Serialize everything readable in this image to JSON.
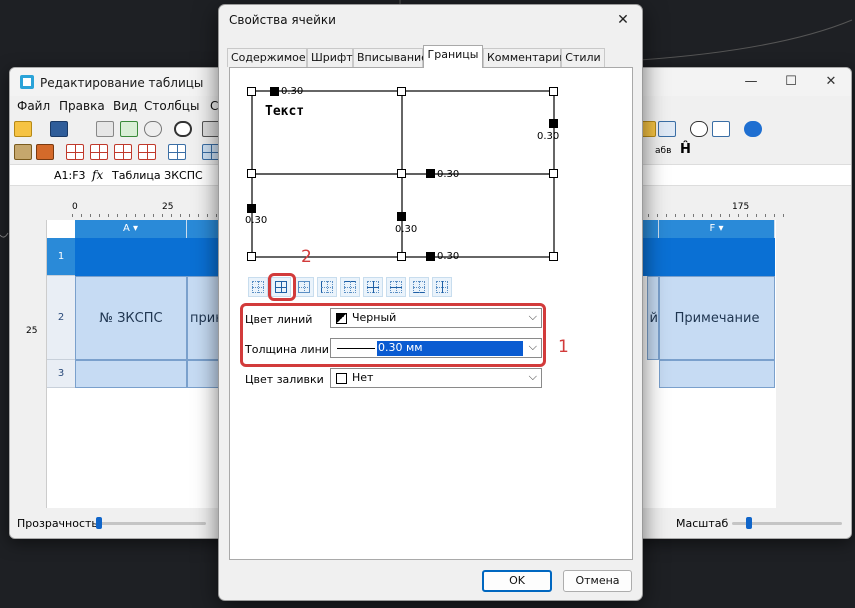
{
  "background_window": {
    "title": "Редактирование таблицы",
    "controls": {
      "minimize": "—",
      "maximize": "☐",
      "close": "✕"
    },
    "menu": [
      "Файл",
      "Правка",
      "Вид",
      "Столбцы",
      "С"
    ],
    "cell_ref": "A1:F3",
    "fx": "fx",
    "formula": "Таблица ЗКСПС",
    "ruler_marks": [
      "0",
      "25",
      "175"
    ],
    "ruler_v_mark": "25",
    "columns": [
      "A",
      "F"
    ],
    "rows": [
      "1",
      "2",
      "3"
    ],
    "cells": {
      "a2": "№ ЗКСПС",
      "b2": "прин",
      "e2": "й",
      "f2": "Примечание"
    },
    "toolbar_text": {
      "abv": "абв",
      "h": "Ĥ"
    },
    "status": {
      "transparency_label": "Прозрачность",
      "scale_label": "Масштаб"
    }
  },
  "dialog": {
    "title": "Свойства ячейки",
    "close": "✕",
    "tabs": [
      "Содержимое",
      "Шрифт",
      "Вписывание",
      "Границы",
      "Комментарий",
      "Стили"
    ],
    "active_tab": "Границы",
    "preview": {
      "text": "Текст",
      "labels": {
        "top_left": "0.30",
        "right_top": "0.30",
        "mid_h_right": "0.30",
        "left_bottom": "0.30",
        "inner_v": "0.30",
        "bottom_right": "0.30"
      }
    },
    "fields": {
      "line_color_label": "Цвет линий",
      "line_color_value": "Черный",
      "line_width_label": "Толщина линий",
      "line_width_value": "0.30 мм",
      "fill_color_label": "Цвет заливки",
      "fill_color_value": "Нет"
    },
    "annotations": {
      "one": "1",
      "two": "2"
    },
    "ok_label": "OK",
    "cancel_label": "Отмена"
  },
  "colors": {
    "accent": "#0a70d4",
    "annotation": "#d23b3b",
    "cell_fill": "#c6dbf3",
    "selection": "#0a5bd1"
  }
}
